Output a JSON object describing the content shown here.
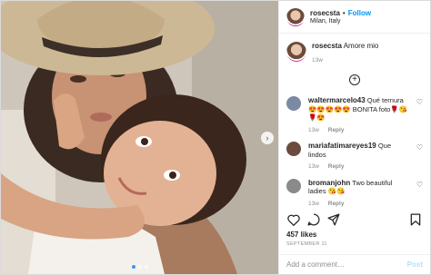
{
  "post": {
    "username": "rosecsta",
    "follow_label": "Follow",
    "separator": "•",
    "location": "Milan, Italy",
    "photo_icon": "next-arrow-icon",
    "carousel": {
      "count": 3,
      "active": 1
    }
  },
  "caption": {
    "username": "rosecsta",
    "text": "Amore mio",
    "time": "13w"
  },
  "load_more_icon": "plus-circle-icon",
  "comments": [
    {
      "username": "waltermarcelo43",
      "text": "Qué ternura 😍😍😍😍😍 BONITA foto🌹😘🌹😍",
      "time": "13w",
      "reply": "Reply",
      "avatar_color": "#7a8aa3"
    },
    {
      "username": "mariafatimareyes19",
      "text": "Que lindos",
      "time": "13w",
      "reply": "Reply",
      "avatar_color": "#6d4a3e"
    },
    {
      "username": "bromanjohn",
      "text": "Two beautiful ladies 😘😘",
      "time": "13w",
      "reply": "Reply",
      "avatar_color": "#8a8a8a"
    }
  ],
  "actions": {
    "like": "heart-icon",
    "comment": "comment-icon",
    "share": "share-icon",
    "save": "bookmark-icon"
  },
  "likes": "457 likes",
  "date": "SEPTEMBER 11",
  "add_comment": {
    "placeholder": "Add a comment…",
    "post_label": "Post"
  },
  "colors": {
    "link": "#0095f6",
    "muted": "#8e8e8e",
    "text": "#262626"
  }
}
